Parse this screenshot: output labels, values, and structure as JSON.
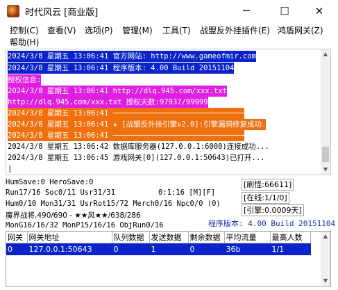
{
  "window": {
    "title": "时代风云 [商业版]",
    "controls": {
      "minimize": "─",
      "maximize": "☐",
      "close": "✕"
    }
  },
  "menu": {
    "items": [
      {
        "label": "控制(C)"
      },
      {
        "label": "查看(V)"
      },
      {
        "label": "选项(P)"
      },
      {
        "label": "管理(M)"
      },
      {
        "label": "工具(T)"
      },
      {
        "label": "战盟反外挂插件(E)"
      },
      {
        "label": "鸿盾网关(Z)"
      },
      {
        "label": "帮助(H)"
      }
    ]
  },
  "log": {
    "lines": [
      {
        "text": "2024/3/8 星期五 13:06:41 官方网站: http://www.gameofmir.com",
        "fg": "#ffffff",
        "bg": "#0a24c9"
      },
      {
        "text": "2024/3/8 星期五 13:06:41 程序版本: 4.00 Build 20151104",
        "fg": "#ffffff",
        "bg": "#0a24c9"
      },
      {
        "text": "授权信息:",
        "fg": "#ffffff",
        "bg": "#e020e0"
      },
      {
        "text": "2024/3/8 星期五 13:06:41 http://dlq.945.com/xxx.txt",
        "fg": "#ffffff",
        "bg": "#e020e0"
      },
      {
        "text": "http://dlq.945.com/xxx.txt 授权天数:97937/99999",
        "fg": "#ffffff",
        "bg": "#e020e0"
      },
      {
        "text": "2024/3/8 星期五 13:06:41 ──────────────────────────────",
        "fg": "#ffffff",
        "bg": "#f07010"
      },
      {
        "text": "2024/3/8 星期五 13:06:41 ★ [战盟反外挂引擎v2.0]:引擎漏洞修复成功.",
        "fg": "#ffffff",
        "bg": "#f07010"
      },
      {
        "text": "2024/3/8 星期五 13:06:41 ──────────────────────────────",
        "fg": "#ffffff",
        "bg": "#f07010"
      },
      {
        "text": "2024/3/8 星期五 13:06:42 数据库服务器(127.0.0.1:6000)连接成功...",
        "fg": "#000000",
        "bg": "transparent"
      },
      {
        "text": "2024/3/8 星期五 13:06:45 游戏网关[0](127.0.0.1:50643)已打开...",
        "fg": "#000000",
        "bg": "transparent"
      },
      {
        "text": "|",
        "fg": "#000000",
        "bg": "transparent"
      }
    ]
  },
  "status": {
    "hum_save": "HumSave:0 HeroSave:0",
    "run": "Run17/16 Soc0/11 Usr31/31",
    "clock": "0:1:16 [M][F]",
    "hum": "Hum0/10 Mon31/31 UsrRot15/72 Merch0/16 Npc0/0 (0)",
    "magic": "魔界战将,490/690 - ★★风★★/638/286",
    "mon": "MonG16/16/32 MonP15/16/16 ObjRun0/16",
    "refresh_monster": "[刷怪:66611]",
    "online": "[在线:1/1/0]",
    "engine": "[引擎:0.0009天]",
    "version": "程序版本: 4.00 Build 20151104"
  },
  "gateway_table": {
    "columns": [
      "网关",
      "网关地址",
      "队列数据",
      "发送数据",
      "剩余数据",
      "平均流量",
      "最高人数"
    ],
    "rows": [
      [
        "0",
        "127.0.0.1:50643",
        "0",
        "1",
        "0",
        "36b",
        "1/1"
      ]
    ]
  },
  "colors": {
    "log_blue": "#0a24c9",
    "log_magenta": "#e020e0",
    "log_orange": "#f07010",
    "version_text": "#1a2fa8",
    "row_selected": "#0a24c9"
  }
}
